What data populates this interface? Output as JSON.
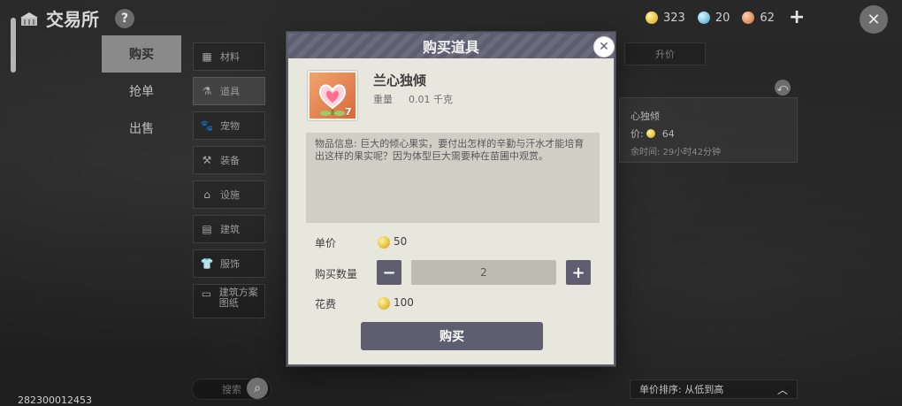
{
  "topbar": {
    "title": "交易所",
    "help_glyph": "?",
    "currencies": [
      {
        "icon": "gold-coin-icon",
        "value": "323"
      },
      {
        "icon": "blue-gem-icon",
        "value": "20"
      },
      {
        "icon": "coral-token-icon",
        "value": "62"
      }
    ],
    "add_glyph": "+",
    "close_glyph": "✕"
  },
  "left_tabs": [
    {
      "label": "购买",
      "active": true
    },
    {
      "label": "抢单",
      "active": false
    },
    {
      "label": "出售",
      "active": false
    }
  ],
  "categories": [
    {
      "label": "材料",
      "icon": "materials-icon",
      "active": false
    },
    {
      "label": "道具",
      "icon": "props-icon",
      "active": true
    },
    {
      "label": "宠物",
      "icon": "pet-icon",
      "active": false
    },
    {
      "label": "装备",
      "icon": "equipment-icon",
      "active": false
    },
    {
      "label": "设施",
      "icon": "facility-icon",
      "active": false
    },
    {
      "label": "建筑",
      "icon": "building-icon",
      "active": false
    },
    {
      "label": "服饰",
      "icon": "clothing-icon",
      "active": false
    },
    {
      "label": "建筑方案图纸",
      "icon": "blueprint-icon",
      "active": false
    }
  ],
  "left_bottom": {
    "search_placeholder": "搜索"
  },
  "bottom_id": "282300012453",
  "right_panel": {
    "tab_label": "升价",
    "card": {
      "title": "心独倾",
      "price_label": "价:",
      "price_value": "64",
      "time_text": "余时间: 29小时42分钟"
    },
    "sort_label": "单价排序: 从低到高",
    "sort_glyph": "︿"
  },
  "modal": {
    "title": "购买道具",
    "close_glyph": "✕",
    "item": {
      "name": "兰心独倾",
      "count": "7",
      "weight_label": "重量",
      "weight_value": "0.01 千克",
      "description": "物品信息: 巨大的倾心果实，要付出怎样的辛勤与汗水才能培育出这样的果实呢？因为体型巨大需要种在苗圃中观赏。"
    },
    "unit_price_label": "单价",
    "unit_price_value": "50",
    "quantity_label": "购买数量",
    "quantity_value": "2",
    "cost_label": "花费",
    "cost_value": "100",
    "buy_button": "购买",
    "minus_glyph": "−",
    "plus_glyph": "+"
  }
}
